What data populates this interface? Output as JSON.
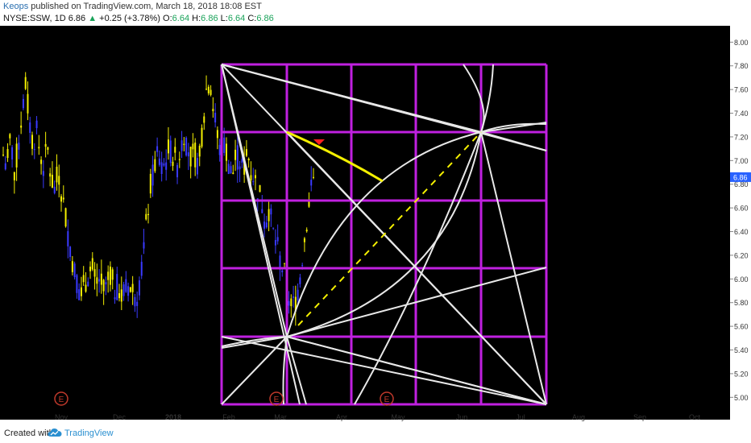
{
  "header": {
    "author": "Keops",
    "published_text": "published on TradingView.com, March 18, 2018 18:08 EST",
    "symbol": "NYSE:SSW, 1D",
    "last": "6.86",
    "change_arrow": "▲",
    "change": "+0.25 (+3.78%)",
    "ohlc": [
      {
        "label": "O:",
        "value": "6.64"
      },
      {
        "label": "H:",
        "value": "6.86"
      },
      {
        "label": "L:",
        "value": "6.64"
      },
      {
        "label": "C:",
        "value": "6.86"
      }
    ]
  },
  "footer": {
    "created_with": "Created with",
    "brand": "TradingView"
  },
  "colors": {
    "background": "#000000",
    "bull_candle": "#3a3aff",
    "bear_candle": "#f4f000",
    "grid_purple": "#c020e0",
    "fan_lines": "#e8e8e8",
    "highlight_yellow": "#f4f000",
    "price_tag": "#2962ff",
    "earnings_marker": "#c0392b"
  },
  "chart_data": {
    "type": "candlestick",
    "y_axis": {
      "ylim": [
        4.9,
        8.05
      ],
      "ticks": [
        "8.00",
        "7.80",
        "7.60",
        "7.40",
        "7.20",
        "7.00",
        "6.80",
        "6.60",
        "6.40",
        "6.20",
        "6.00",
        "5.80",
        "5.60",
        "5.40",
        "5.20",
        "5.00"
      ],
      "current_price_tag": "6.86"
    },
    "x_axis": {
      "ticks": [
        {
          "label": "Nov",
          "bold": false
        },
        {
          "label": "Dec",
          "bold": false
        },
        {
          "label": "2018",
          "bold": true
        },
        {
          "label": "Feb",
          "bold": false
        },
        {
          "label": "Mar",
          "bold": false
        },
        {
          "label": "Apr",
          "bold": false
        },
        {
          "label": "May",
          "bold": false
        },
        {
          "label": "Jun",
          "bold": false
        },
        {
          "label": "Jul",
          "bold": false
        },
        {
          "label": "Aug",
          "bold": false
        },
        {
          "label": "Sep",
          "bold": false
        },
        {
          "label": "Oct",
          "bold": false
        }
      ]
    },
    "earnings_markers": [
      "E",
      "E",
      "E"
    ],
    "close_path": [
      7.05,
      6.95,
      7.2,
      6.9,
      7.1,
      7.4,
      7.65,
      7.35,
      7.15,
      7.25,
      7.05,
      6.95,
      7.1,
      6.85,
      6.75,
      6.9,
      6.7,
      6.5,
      6.3,
      6.1,
      6.0,
      5.85,
      5.95,
      6.05,
      6.1,
      5.95,
      6.0,
      5.9,
      5.95,
      6.05,
      5.9,
      5.95,
      5.85,
      5.9,
      5.95,
      5.9,
      5.85,
      6.0,
      6.2,
      6.55,
      6.8,
      6.95,
      7.05,
      6.9,
      7.0,
      7.1,
      7.05,
      6.95,
      7.1,
      7.25,
      7.1,
      7.0,
      7.05,
      6.95,
      7.3,
      7.6,
      7.7,
      7.4,
      7.2,
      7.05,
      7.15,
      7.0,
      6.85,
      7.05,
      7.0,
      6.9,
      7.1,
      6.95,
      6.85,
      6.75,
      6.65,
      6.5,
      6.6,
      6.4,
      6.3,
      6.15,
      6.05,
      5.9,
      5.75,
      5.8,
      5.95,
      6.2,
      6.45,
      6.7,
      6.86
    ]
  }
}
